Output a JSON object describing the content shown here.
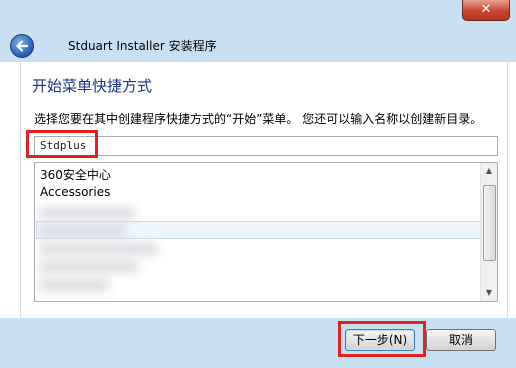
{
  "window": {
    "close_glyph": "✕",
    "title": "Stduart Installer 安装程序"
  },
  "page": {
    "heading": "开始菜单快捷方式",
    "instruction": "选择您要在其中创建程序快捷方式的“开始”菜单。 您还可以输入名称以创建新目录。"
  },
  "folder_input": {
    "value": "Stdplus"
  },
  "folder_list": {
    "items": [
      "360安全中心",
      "Accessories"
    ]
  },
  "buttons": {
    "next": "下一步(N)",
    "cancel": "取消"
  },
  "colors": {
    "highlight": "#e0231c",
    "chrome": "#c9e0f3",
    "heading": "#1e3287"
  }
}
